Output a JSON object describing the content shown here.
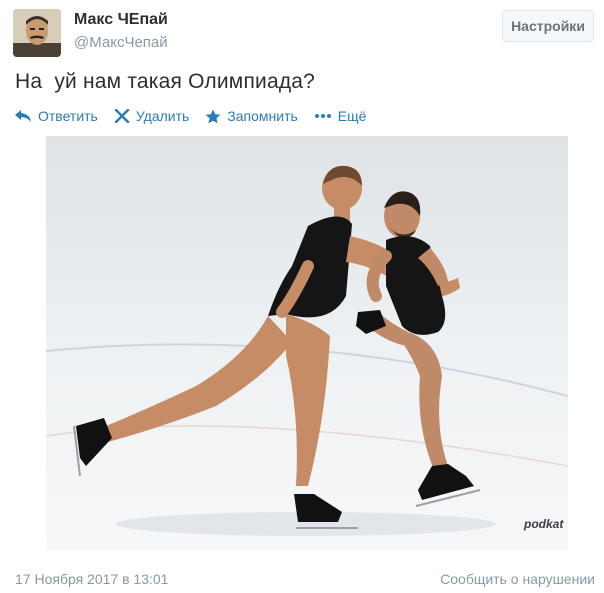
{
  "user": {
    "display_name": "Макс ЧЕпай",
    "handle": "@МаксЧепай"
  },
  "header": {
    "settings_label": "Настройки"
  },
  "tweet": {
    "text": "На  уй нам такая Олимпиада?"
  },
  "actions": [
    {
      "label": "Ответить",
      "icon": "reply-icon"
    },
    {
      "label": "Удалить",
      "icon": "delete-icon"
    },
    {
      "label": "Запомнить",
      "icon": "star-icon"
    },
    {
      "label": "Ещё",
      "icon": "more-icon"
    }
  ],
  "photo": {
    "watermark": "podkat"
  },
  "footer": {
    "timestamp": "17 Ноября 2017 в 13:01",
    "report_label": "Сообщить о нарушении"
  },
  "colors": {
    "link": "#2b7bb9",
    "muted": "#8899a6",
    "text": "#292f33"
  }
}
